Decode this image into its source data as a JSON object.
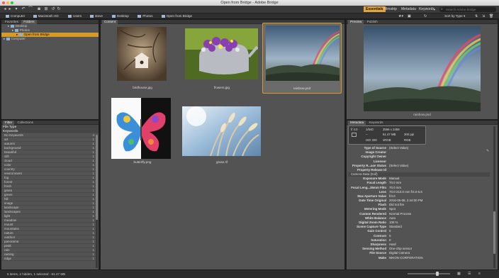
{
  "window": {
    "title": "Open from Bridge - Adobe Bridge"
  },
  "workspaces": [
    {
      "label": "Essentials",
      "active": true
    },
    {
      "label": "Filmstrip",
      "active": false
    },
    {
      "label": "Metadata",
      "active": false
    },
    {
      "label": "Keywords",
      "active": false
    }
  ],
  "search": {
    "placeholder": "Search Adobe Bridge"
  },
  "breadcrumb": [
    "Computer",
    "Macintosh HD",
    "Users",
    "steve",
    "Desktop",
    "Photos",
    "Open from Bridge"
  ],
  "sort": {
    "label": "Sort by Type"
  },
  "left_panel": {
    "tabs": [
      "Favorites",
      "Folders"
    ],
    "tree": [
      {
        "label": "Desktop",
        "level": 1,
        "selected": false
      },
      {
        "label": "Photos",
        "level": 2,
        "selected": false
      },
      {
        "label": "Open from Bridge",
        "level": 3,
        "selected": true
      },
      {
        "label": "Computer",
        "level": 0,
        "selected": false
      }
    ]
  },
  "filter_panel": {
    "tabs": [
      "Filter",
      "Collections"
    ],
    "file_type_label": "File Type",
    "keywords_label": "Keywords",
    "keywords": [
      {
        "name": "No Keywords",
        "count": "4"
      },
      {
        "name": "art",
        "count": "1"
      },
      {
        "name": "autumn",
        "count": "1"
      },
      {
        "name": "background",
        "count": "1"
      },
      {
        "name": "beautiful",
        "count": "1"
      },
      {
        "name": "clift",
        "count": "1"
      },
      {
        "name": "cloud",
        "count": "1"
      },
      {
        "name": "color",
        "count": "1"
      },
      {
        "name": "country",
        "count": "1"
      },
      {
        "name": "environment",
        "count": "1"
      },
      {
        "name": "fog",
        "count": "1"
      },
      {
        "name": "forest",
        "count": "1"
      },
      {
        "name": "fresh",
        "count": "1"
      },
      {
        "name": "grass",
        "count": "1"
      },
      {
        "name": "green",
        "count": "1"
      },
      {
        "name": "hill",
        "count": "1"
      },
      {
        "name": "image",
        "count": "1"
      },
      {
        "name": "landscape",
        "count": "1"
      },
      {
        "name": "landscapes",
        "count": "1"
      },
      {
        "name": "light",
        "count": "1"
      },
      {
        "name": "meadow",
        "count": "1"
      },
      {
        "name": "mount",
        "count": "1"
      },
      {
        "name": "mountains",
        "count": "1"
      },
      {
        "name": "nature",
        "count": "1"
      },
      {
        "name": "outdoor",
        "count": "1"
      },
      {
        "name": "panorama",
        "count": "1"
      },
      {
        "name": "peak",
        "count": "1"
      },
      {
        "name": "rain",
        "count": "1"
      },
      {
        "name": "raining",
        "count": "1"
      },
      {
        "name": "ridge",
        "count": "1"
      }
    ]
  },
  "content": {
    "tab": "Content",
    "items": [
      {
        "name": "birdhouse.jpg",
        "selected": false
      },
      {
        "name": "flowers.jpg",
        "selected": false
      },
      {
        "name": "rainbow.psd",
        "selected": true
      },
      {
        "name": "butterfly.png",
        "selected": false
      },
      {
        "name": "grass.tif",
        "selected": false
      }
    ]
  },
  "preview": {
    "tabs": [
      "Preview",
      "Publish"
    ],
    "caption": "rainbow.psd"
  },
  "metadata": {
    "tabs": [
      "Metadata",
      "Keywords"
    ],
    "summary": {
      "aperture": "f/ 4.0",
      "shutter": "1/640",
      "dimensions": "3556 x 2459",
      "exposure": "--",
      "size": "61.47 MB",
      "resolution": "300 ppi",
      "iso": "ISO 200",
      "profile": "sRGB",
      "mode": "RGB"
    },
    "rows_top": [
      {
        "k": "Type of Source",
        "v": "(Select Value)"
      },
      {
        "k": "Image Creator",
        "v": ""
      },
      {
        "k": "Copyright Owner",
        "v": ""
      },
      {
        "k": "Licensor",
        "v": ""
      },
      {
        "k": "Property R...ase Status",
        "v": "(Select Value)"
      },
      {
        "k": "Property Release Id",
        "v": ""
      }
    ],
    "camera_section": "Camera Data (Exif)",
    "rows_camera": [
      {
        "k": "Exposure Mode",
        "v": "Manual"
      },
      {
        "k": "Focal Length",
        "v": "70.0 mm"
      },
      {
        "k": "Focal Leng...35mm Film",
        "v": "70.0 mm"
      },
      {
        "k": "Lens",
        "v": "70.0-210.0 mm f/4.0-5.6"
      },
      {
        "k": "Max Aperture Value",
        "v": "f/4.0"
      },
      {
        "k": "Date Time Original",
        "v": "2016-05-08, 2:44:00 PM"
      },
      {
        "k": "Flash",
        "v": "Did not fire"
      },
      {
        "k": "Metering Mode",
        "v": "Spot"
      },
      {
        "k": "Custom Rendered",
        "v": "Normal Process"
      },
      {
        "k": "White Balance",
        "v": "Auto"
      },
      {
        "k": "Digital Zoom Ratio",
        "v": "100 %"
      },
      {
        "k": "Scene Capture Type",
        "v": "Standard"
      },
      {
        "k": "Gain Control",
        "v": "0"
      },
      {
        "k": "Contrast",
        "v": "0"
      },
      {
        "k": "Saturation",
        "v": "0"
      },
      {
        "k": "Sharpness",
        "v": "Hard"
      },
      {
        "k": "Sensing Method",
        "v": "One-chip sensor"
      },
      {
        "k": "File Source",
        "v": "Digital Camera"
      },
      {
        "k": "Make",
        "v": "NIKON CORPORATION"
      }
    ]
  },
  "status": {
    "text": "5 items, 2 hidden, 1 selected - 61.47 MB"
  },
  "colors": {
    "accent": "#d69b26",
    "panel": "#535353",
    "background": "#1e1e1e"
  },
  "icons": [
    "back-arrow-icon",
    "forward-arrow-icon",
    "rotate-icon",
    "boomerang-icon",
    "camera-icon",
    "refine-icon",
    "open-recent-icon",
    "star-filter-icon",
    "sort-icon",
    "new-folder-icon",
    "trash-icon",
    "search-icon",
    "folder-icon"
  ]
}
